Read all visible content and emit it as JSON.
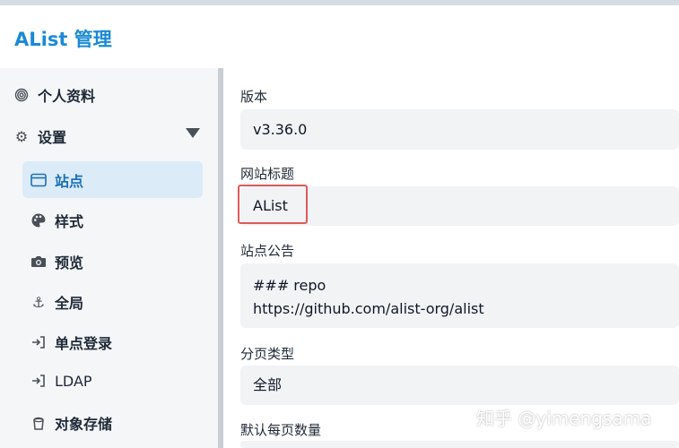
{
  "app": {
    "title": "AList 管理"
  },
  "sidebar": {
    "items": [
      {
        "label": "个人资料",
        "icon": "fingerprint-icon"
      },
      {
        "label": "设置",
        "icon": "gear-icon"
      },
      {
        "label": "站点",
        "icon": "window-icon",
        "active": true
      },
      {
        "label": "样式",
        "icon": "palette-icon"
      },
      {
        "label": "预览",
        "icon": "camera-icon"
      },
      {
        "label": "全局",
        "icon": "anchor-icon"
      },
      {
        "label": "单点登录",
        "icon": "login-arrow-icon"
      },
      {
        "label": "LDAP",
        "icon": "login-arrow-icon"
      },
      {
        "label": "对象存储",
        "icon": "bucket-icon"
      }
    ]
  },
  "settings": {
    "version": {
      "label": "版本",
      "value": "v3.36.0"
    },
    "site_title": {
      "label": "网站标题",
      "value": "AList"
    },
    "announcement": {
      "label": "站点公告",
      "line1": "### repo",
      "line2": "https://github.com/alist-org/alist"
    },
    "pagination_type": {
      "label": "分页类型",
      "value": "全部"
    },
    "default_page_size": {
      "label": "默认每页数量"
    }
  },
  "watermark": "知乎 @yimengsama",
  "colors": {
    "accent": "#1a8ad6",
    "active_bg": "#dcebf8",
    "highlight": "#e05a5a"
  }
}
